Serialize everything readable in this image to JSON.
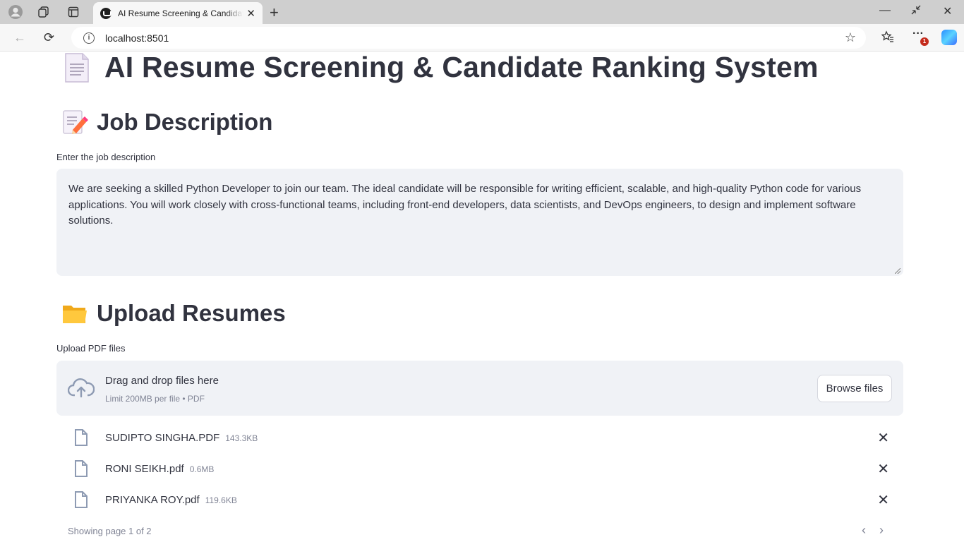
{
  "browser": {
    "tab_title": "AI Resume Screening & Candidate Ranking System",
    "url": "localhost:8501",
    "notification_count": "1"
  },
  "page": {
    "title": "AI Resume Screening & Candidate Ranking System",
    "job_section": {
      "heading": "Job Description",
      "input_label": "Enter the job description",
      "input_value": "We are seeking a skilled Python Developer to join our team. The ideal candidate will be responsible for writing efficient, scalable, and high-quality Python code for various applications. You will work closely with cross-functional teams, including front-end developers, data scientists, and DevOps engineers, to design and implement software solutions."
    },
    "upload_section": {
      "heading": "Upload Resumes",
      "input_label": "Upload PDF files",
      "drop_text": "Drag and drop files here",
      "limit_text": "Limit 200MB per file • PDF",
      "browse_label": "Browse files",
      "files": [
        {
          "name": "SUDIPTO SINGHA.PDF",
          "size": "143.3KB"
        },
        {
          "name": "RONI SEIKH.pdf",
          "size": "0.6MB"
        },
        {
          "name": "PRIYANKA ROY.pdf",
          "size": "119.6KB"
        }
      ],
      "pagination": "Showing page 1 of 2"
    }
  },
  "colors": {
    "text": "#31333f",
    "muted": "#808495",
    "input_bg": "#f0f2f6"
  }
}
